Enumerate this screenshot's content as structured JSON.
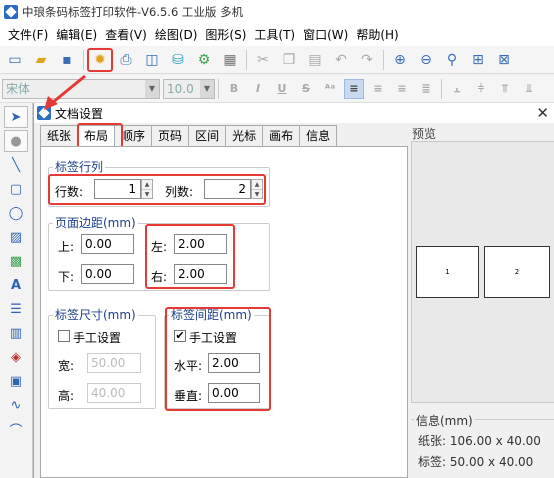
{
  "window": {
    "title": "中琅条码标签打印软件-V6.5.6 工业版 多机"
  },
  "menu": [
    "文件(F)",
    "编辑(E)",
    "查看(V)",
    "绘图(D)",
    "图形(S)",
    "工具(T)",
    "窗口(W)",
    "帮助(H)"
  ],
  "toolbar2": {
    "font": "宋体",
    "size": "10.0",
    "bold": "B",
    "italic": "I",
    "underline": "U",
    "strike": "S"
  },
  "dialog": {
    "title": "文档设置",
    "close": "✕",
    "tabs": [
      "纸张",
      "布局",
      "顺序",
      "页码",
      "区间",
      "光标",
      "画布",
      "信息"
    ],
    "active_tab": "布局",
    "rows_cols": {
      "title": "标签行列",
      "rows_label": "行数:",
      "rows_value": "1",
      "cols_label": "列数:",
      "cols_value": "2"
    },
    "margins": {
      "title": "页面边距(mm)",
      "top_label": "上:",
      "top_value": "0.00",
      "bottom_label": "下:",
      "bottom_value": "0.00",
      "left_label": "左:",
      "left_value": "2.00",
      "right_label": "右:",
      "right_value": "2.00"
    },
    "label_size": {
      "title": "标签尺寸(mm)",
      "manual_label": "手工设置",
      "manual_checked": false,
      "width_label": "宽:",
      "width_value": "50.00",
      "height_label": "高:",
      "height_value": "40.00"
    },
    "label_gap": {
      "title": "标签间距(mm)",
      "manual_label": "手工设置",
      "manual_checked": true,
      "h_label": "水平:",
      "h_value": "2.00",
      "v_label": "垂直:",
      "v_value": "0.00"
    },
    "preview": {
      "title": "预览",
      "labels": [
        "1",
        "2"
      ]
    },
    "info": {
      "title": "信息(mm)",
      "paper": "纸张: 106.00 x 40.00",
      "label": "标签: 50.00 x 40.00"
    }
  },
  "colors": {
    "highlight": "#e53935",
    "group_title": "#1d3f8a",
    "accent": "#2f62b0"
  }
}
